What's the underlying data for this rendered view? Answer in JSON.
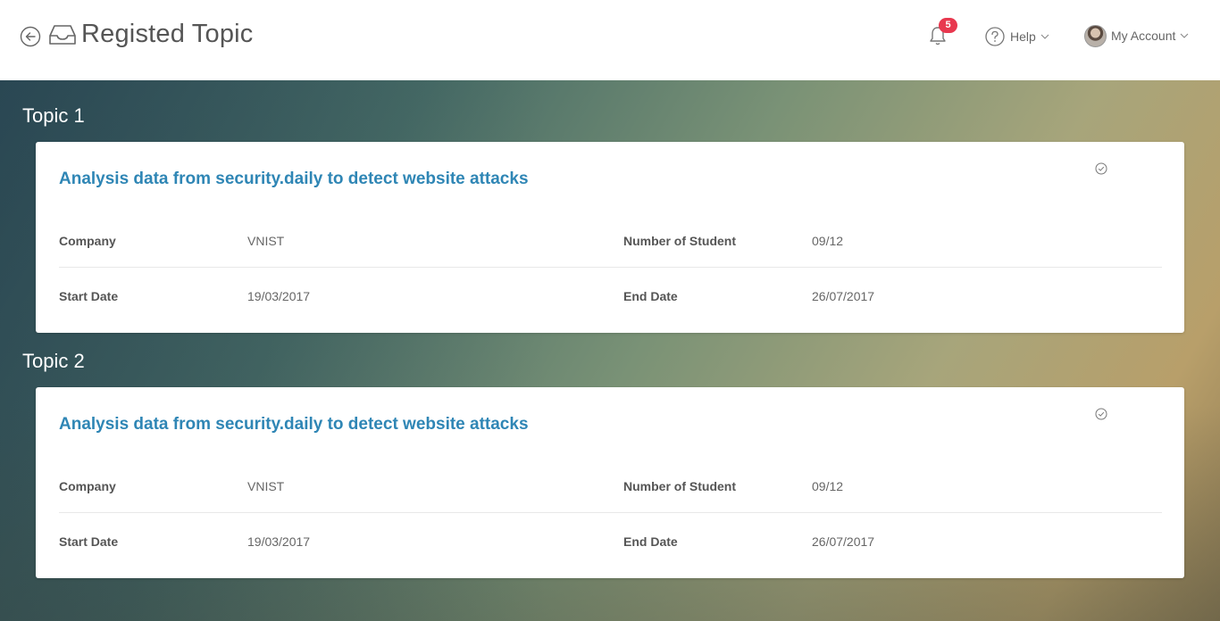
{
  "header": {
    "title": "Registed Topic",
    "notifications_count": "5",
    "help_label": "Help",
    "account_label": "My Account"
  },
  "topics": [
    {
      "label": "Topic 1",
      "title": "Analysis data from security.daily to detect website attacks",
      "company_label": "Company",
      "company": "VNIST",
      "students_label": "Number of Student",
      "students": "09/12",
      "start_label": "Start Date",
      "start": "19/03/2017",
      "end_label": "End Date",
      "end": "26/07/2017"
    },
    {
      "label": "Topic 2",
      "title": "Analysis data from security.daily to detect website attacks",
      "company_label": "Company",
      "company": "VNIST",
      "students_label": "Number of Student",
      "students": "09/12",
      "start_label": "Start Date",
      "start": "19/03/2017",
      "end_label": "End Date",
      "end": "26/07/2017"
    }
  ],
  "colors": {
    "accent": "#2f86b5",
    "badge": "#e8384f"
  }
}
